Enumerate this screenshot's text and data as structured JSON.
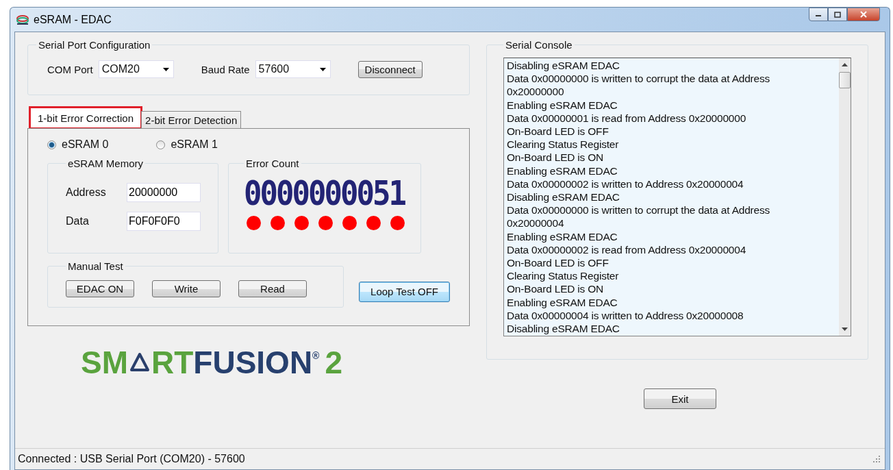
{
  "window": {
    "title": "eSRAM - EDAC"
  },
  "serial_port": {
    "title": "Serial Port Configuration",
    "com_label": "COM Port",
    "com_value": "COM20",
    "baud_label": "Baud Rate",
    "baud_value": "57600",
    "button": "Disconnect"
  },
  "tabs": [
    {
      "label": "1-bit Error Correction",
      "selected": true,
      "highlighted": true
    },
    {
      "label": "2-bit Error Detection",
      "selected": false,
      "highlighted": false
    }
  ],
  "radios": [
    {
      "label": "eSRAM 0",
      "selected": true
    },
    {
      "label": "eSRAM 1",
      "selected": false
    }
  ],
  "memory": {
    "title": "eSRAM Memory",
    "address_label": "Address",
    "address_value": "20000000",
    "data_label": "Data",
    "data_value": "F0F0F0F0"
  },
  "error_count": {
    "title": "Error Count",
    "value": "0000000051",
    "leds": [
      {
        "color": "#ff0000"
      },
      {
        "color": "#ff0000"
      },
      {
        "color": "#ff0000"
      },
      {
        "color": "#ff0000"
      },
      {
        "color": "#ff0000"
      },
      {
        "color": "#ff0000"
      },
      {
        "color": "#ff0000"
      }
    ]
  },
  "manual_test": {
    "title": "Manual Test",
    "buttons": [
      "EDAC ON",
      "Write",
      "Read"
    ]
  },
  "loop_button": {
    "label": "Loop Test OFF",
    "focused": true
  },
  "console": {
    "title": "Serial Console",
    "lines": [
      "Disabling eSRAM EDAC",
      "Data 0x00000000 is written to corrupt the data at Address",
      "0x20000000",
      "Enabling eSRAM EDAC",
      "Data 0x00000001 is read from Address 0x20000000",
      "On-Board LED is OFF",
      "Clearing Status Register",
      "On-Board LED is ON",
      "Enabling eSRAM EDAC",
      "Data 0x00000002 is written to Address 0x20000004",
      "Disabling eSRAM EDAC",
      "Data 0x00000000 is written to corrupt the data at Address",
      "0x20000004",
      "Enabling eSRAM EDAC",
      "Data 0x00000002 is read from Address 0x20000004",
      "On-Board LED is OFF",
      "Clearing Status Register",
      "On-Board LED is ON",
      "Enabling eSRAM EDAC",
      "Data 0x00000004 is written to Address 0x20000008",
      "Disabling eSRAM EDAC"
    ]
  },
  "logo": {
    "left": "SM",
    "middle": "RT",
    "right": "FUSION",
    "mark": "®",
    "suffix": "2"
  },
  "exit_button": "Exit",
  "status_bar": "Connected : USB Serial Port (COM20) - 57600"
}
